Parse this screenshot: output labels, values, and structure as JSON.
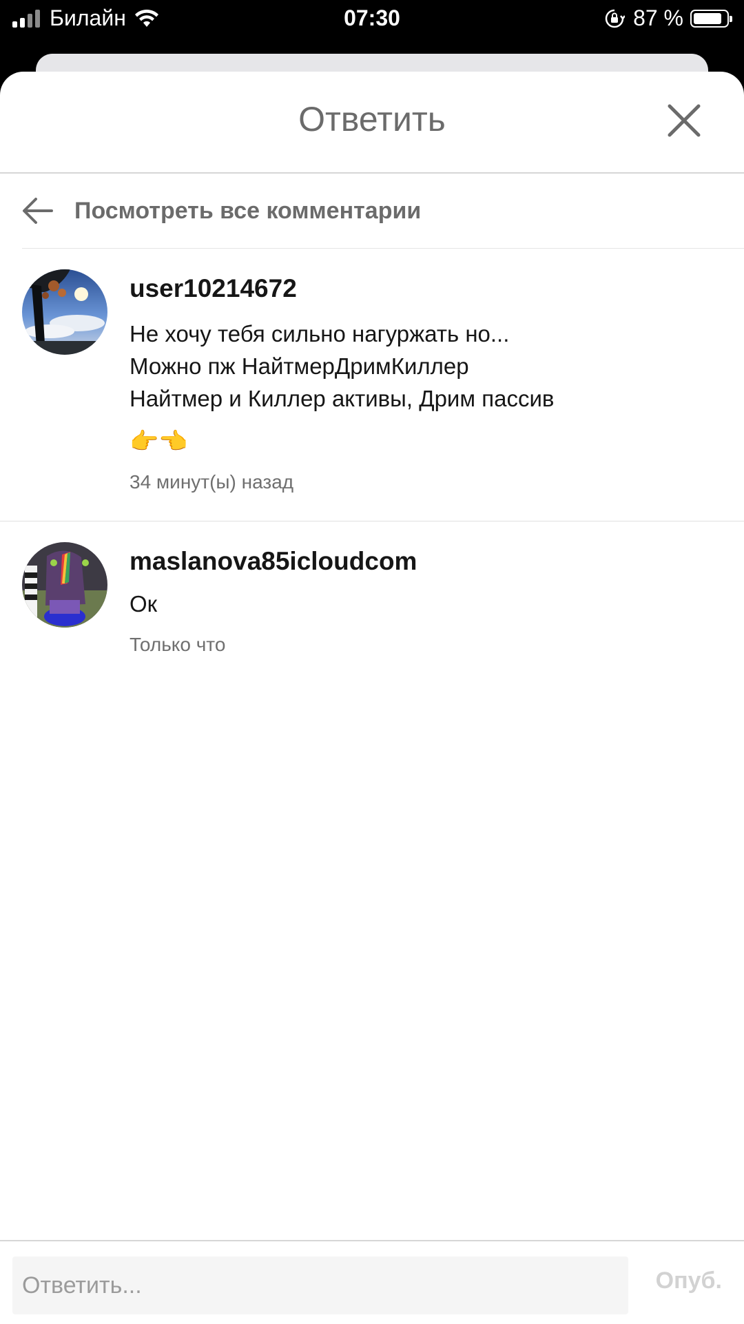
{
  "status_bar": {
    "carrier": "Билайн",
    "time": "07:30",
    "battery_percent": "87 %",
    "battery_level": 0.87
  },
  "sheet": {
    "title": "Ответить",
    "view_all_label": "Посмотреть все комментарии"
  },
  "comments": [
    {
      "username": "user10214672",
      "text": "Не хочу тебя сильно нагуржать но...\nМожно пж НайтмерДримКиллер\nНайтмер и Киллер активы, Дрим пассив",
      "emoji": "👉👈",
      "time": "34 минут(ы) назад"
    },
    {
      "username": "maslanova85icloudcom",
      "text": "Ок",
      "time": "Только что"
    }
  ],
  "reply": {
    "placeholder": "Ответить...",
    "publish_label": "Опуб."
  },
  "colors": {
    "muted_text": "#6b6b6b",
    "disabled_publish": "#d2d2d2"
  }
}
